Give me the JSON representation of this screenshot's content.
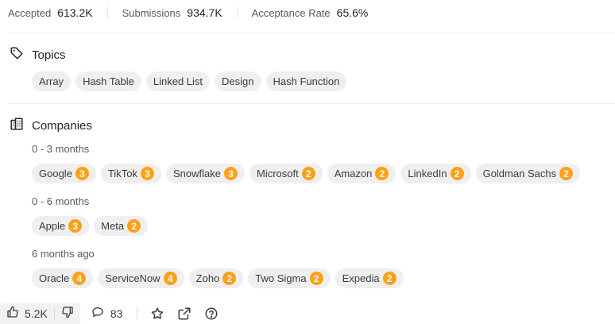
{
  "stats": [
    {
      "label": "Accepted",
      "value": "613.2K"
    },
    {
      "label": "Submissions",
      "value": "934.7K"
    },
    {
      "label": "Acceptance Rate",
      "value": "65.6%"
    }
  ],
  "topics": {
    "title": "Topics",
    "tags": [
      "Array",
      "Hash Table",
      "Linked List",
      "Design",
      "Hash Function"
    ]
  },
  "companies": {
    "title": "Companies",
    "groups": [
      {
        "label": "0 - 3 months",
        "items": [
          {
            "name": "Google",
            "count": "3"
          },
          {
            "name": "TikTok",
            "count": "3"
          },
          {
            "name": "Snowflake",
            "count": "3"
          },
          {
            "name": "Microsoft",
            "count": "2"
          },
          {
            "name": "Amazon",
            "count": "2"
          },
          {
            "name": "LinkedIn",
            "count": "2"
          },
          {
            "name": "Goldman Sachs",
            "count": "2"
          }
        ]
      },
      {
        "label": "0 - 6 months",
        "items": [
          {
            "name": "Apple",
            "count": "3"
          },
          {
            "name": "Meta",
            "count": "2"
          }
        ]
      },
      {
        "label": "6 months ago",
        "items": [
          {
            "name": "Oracle",
            "count": "4"
          },
          {
            "name": "ServiceNow",
            "count": "4"
          },
          {
            "name": "Zoho",
            "count": "2"
          },
          {
            "name": "Two Sigma",
            "count": "2"
          },
          {
            "name": "Expedia",
            "count": "2"
          }
        ]
      }
    ]
  },
  "footer": {
    "likes": "5.2K",
    "comments": "83",
    "icons": [
      "thumbs-up-icon",
      "thumbs-down-icon",
      "comment-icon",
      "star-icon",
      "share-icon",
      "help-icon"
    ]
  },
  "colors": {
    "badge": "#ffa116",
    "chip": "#efefef"
  }
}
